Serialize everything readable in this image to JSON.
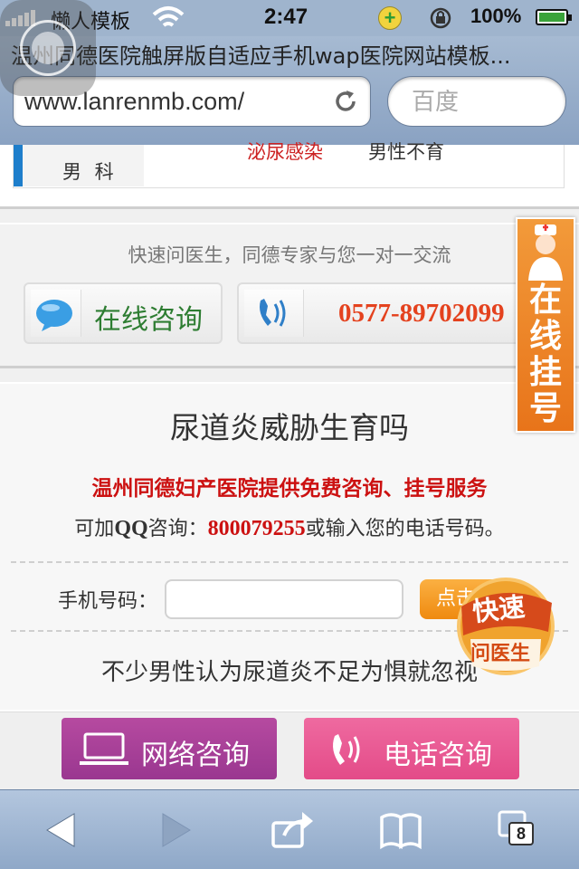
{
  "status_bar": {
    "carrier": "懒人模板",
    "time": "2:47",
    "battery_percent": "100%",
    "signal_bars": 5
  },
  "browser": {
    "page_title": "温州同德医院触屏版自适应手机wap医院网站模板...",
    "url": "www.lanrenmb.com/",
    "search_placeholder": "百度"
  },
  "nav_partial": {
    "category": "男 科",
    "links": [
      "泌尿感染",
      "男性不育"
    ]
  },
  "quick_contact": {
    "slogan": "快速问医生，同德专家与您一对一交流",
    "online_button": "在线咨询",
    "phone_number": "0577-89702099"
  },
  "float_register": {
    "label": "在线挂号"
  },
  "article": {
    "title": "尿道炎威胁生育吗",
    "promo": "温州同德妇产医院提供免费咨询、挂号服务",
    "qq_prefix": "可加",
    "qq_label": "QQ",
    "qq_mid": "咨询：",
    "qq_number": "800079255",
    "qq_suffix": "或输入您的电话号码。",
    "phone_label": "手机号码：",
    "submit_label": "点击",
    "body_text": "不少男性认为尿道炎不足为惧就忽视"
  },
  "float_doctor": {
    "line1": "快速",
    "line2": "问医生"
  },
  "consult_bar": {
    "net_label": "网络咨询",
    "tel_label": "电话咨询"
  },
  "toolbar": {
    "tab_count": "8"
  },
  "colors": {
    "accent_blue": "#1e7ecb",
    "promo_red": "#cc1111",
    "orange": "#e8741a",
    "purple": "#9a3790",
    "pink": "#e34b88"
  }
}
